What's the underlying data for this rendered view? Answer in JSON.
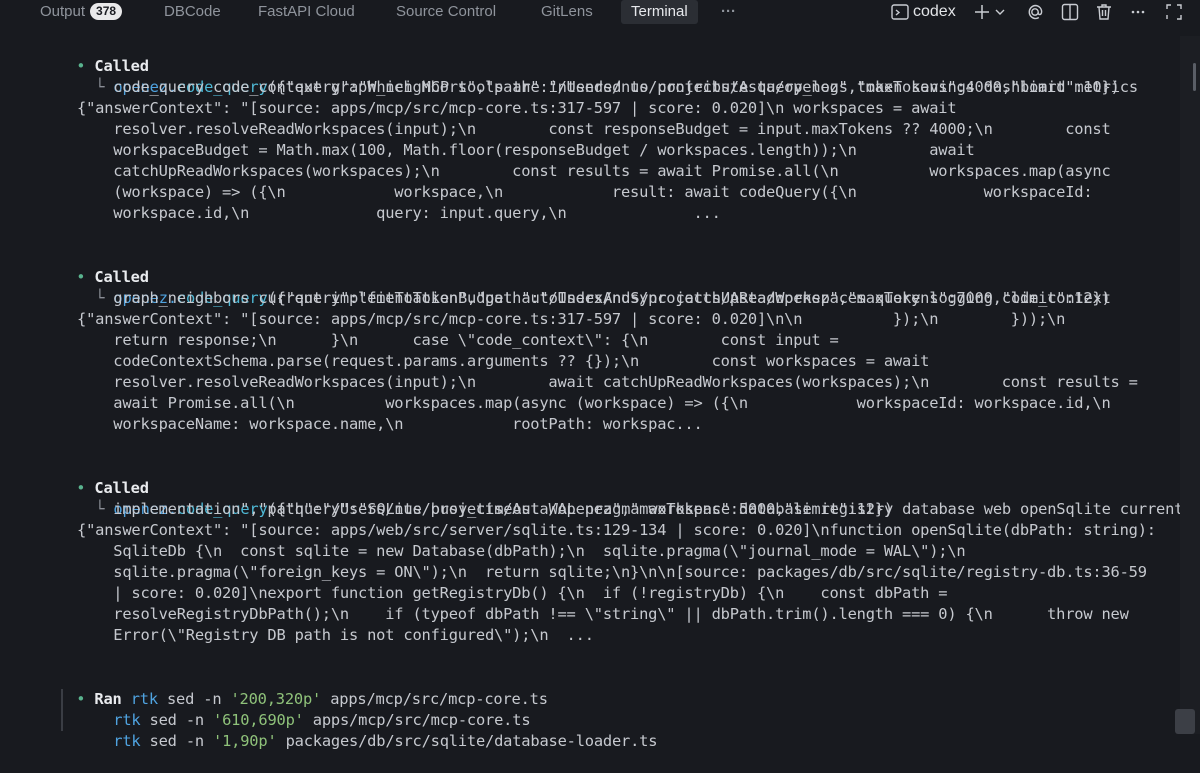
{
  "panel": {
    "tabs": [
      {
        "label": "Output",
        "badge": "378"
      },
      {
        "label": "DBCode"
      },
      {
        "label": "FastAPI Cloud"
      },
      {
        "label": "Source Control"
      },
      {
        "label": "GitLens"
      },
      {
        "label": "Terminal",
        "active": true
      }
    ],
    "more_glyph": "···",
    "terminal_name": "codex",
    "icons": [
      "terminal-icon",
      "plus-icon",
      "chevron-down-icon",
      "at-icon",
      "split-icon",
      "trash-icon",
      "more-icon",
      "maximize-icon"
    ]
  },
  "terminal": {
    "blocks": [
      {
        "status": "Called",
        "server": "openez",
        "tool": "code_query",
        "args_lines": [
          "({\"query\":\"Which MCP tools are intended to contribute query_logs token savings dashboard metrics",
          "    code_query code_context graph_neighbors\",\"path\":\"/Users/nus/projects/Asta/openez\",\"maxTokens\":4000,\"limit\":10})"
        ],
        "output_lines": [
          "{\"answerContext\": \"[source: apps/mcp/src/mcp-core.ts:317-597 | score: 0.020]\\n workspaces = await",
          "    resolver.resolveReadWorkspaces(input);\\n        const responseBudget = input.maxTokens ?? 4000;\\n        const",
          "    workspaceBudget = Math.max(100, Math.floor(responseBudget / workspaces.length));\\n        await",
          "    catchUpReadWorkspaces(workspaces);\\n        const results = await Promise.all(\\n          workspaces.map(async",
          "    (workspace) => ({\\n            workspace,\\n            result: await codeQuery({\\n              workspaceId:",
          "    workspace.id,\\n              query: input.query,\\n              ..."
        ]
      },
      {
        "status": "Called",
        "server": "openez",
        "tool": "code_query",
        "args_lines": [
          "({\"query\":\"fitToTokenBudget autoIndexAndSync catchUpReadWorkspaces query logging code_context",
          "    graph_neighbors current implementation\",\"path\":\"/Users/nus/projects/Asta/openez\",\"maxTokens\":7000,\"limit\":12})"
        ],
        "output_lines": [
          "{\"answerContext\": \"[source: apps/mcp/src/mcp-core.ts:317-597 | score: 0.020]\\n\\n          });\\n        }));\\n",
          "    return response;\\n      }\\n      case \\\"code_context\\\": {\\n        const input =",
          "    codeContextSchema.parse(request.params.arguments ?? {});\\n        const workspaces = await",
          "    resolver.resolveReadWorkspaces(input);\\n        await catchUpReadWorkspaces(workspaces);\\n        const results =",
          "    await Promise.all(\\n          workspaces.map(async (workspace) => ({\\n            workspaceId: workspace.id,\\n",
          "    workspaceName: workspace.name,\\n            rootPath: workspac..."
        ]
      },
      {
        "status": "Called",
        "server": "openez",
        "tool": "code_query",
        "args_lines": [
          "({\"query\":\"SQLite busy_timeout WAL pragma workspace database registry database web openSqlite current",
          "    implementation\",\"path\":\"/Users/nus/projects/Asta/openez\",\"maxTokens\":5000,\"limit\":12})"
        ],
        "output_lines": [
          "{\"answerContext\": \"[source: apps/web/src/server/sqlite.ts:129-134 | score: 0.020]\\nfunction openSqlite(dbPath: string):",
          "    SqliteDb {\\n  const sqlite = new Database(dbPath);\\n  sqlite.pragma(\\\"journal_mode = WAL\\\");\\n",
          "    sqlite.pragma(\\\"foreign_keys = ON\\\");\\n  return sqlite;\\n}\\n\\n[source: packages/db/src/sqlite/registry-db.ts:36-59",
          "    | score: 0.020]\\nexport function getRegistryDb() {\\n  if (!registryDb) {\\n    const dbPath =",
          "    resolveRegistryDbPath();\\n    if (typeof dbPath !== \\\"string\\\" || dbPath.trim().length === 0) {\\n      throw new",
          "    Error(\\\"Registry DB path is not configured\\\");\\n  ..."
        ]
      }
    ],
    "ran": {
      "status": "Ran",
      "commands": [
        {
          "tool": "rtk",
          "cmd": "sed",
          "flag": "-n",
          "range": "'200,320p'",
          "file": "apps/mcp/src/mcp-core.ts"
        },
        {
          "tool": "rtk",
          "cmd": "sed",
          "flag": "-n",
          "range": "'610,690p'",
          "file": "apps/mcp/src/mcp-core.ts"
        },
        {
          "tool": "rtk",
          "cmd": "sed",
          "flag": "-n",
          "range": "'1,90p'",
          "file": "packages/db/src/sqlite/database-loader.ts"
        }
      ]
    }
  }
}
